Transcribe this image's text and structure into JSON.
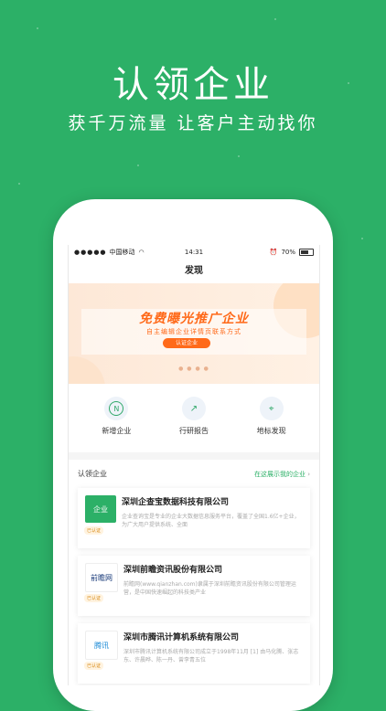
{
  "hero": {
    "title": "认领企业",
    "subtitle": "获千万流量 让客户主动找你"
  },
  "status": {
    "signal": "●●●●●",
    "carrier": "中国移动",
    "wifi": "WiFi",
    "time": "14:31",
    "battery": "70%"
  },
  "nav": {
    "title": "发现"
  },
  "banner": {
    "title": "免费曝光推广企业",
    "subtitle": "自主编辑企业详情页联系方式",
    "button": "认证企业",
    "dots": "● ● ● ●"
  },
  "shortcuts": [
    {
      "label": "新增企业",
      "icon": "N"
    },
    {
      "label": "行研报告",
      "icon": "↗"
    },
    {
      "label": "地标发现",
      "icon": "⌖"
    }
  ],
  "section": {
    "title": "认领企业",
    "link": "在这展示我的企业",
    "chevron": "›"
  },
  "companies": [
    {
      "name": "深圳企查宝数据科技有限公司",
      "logo": "企业",
      "badge": "已认证",
      "desc": "企业查询宝是专业的企业大数据信息服务平台，覆盖了全国1.6亿+企业，为广大用户提供系统、全面"
    },
    {
      "name": "深圳前瞻资讯股份有限公司",
      "logo": "前瞻网",
      "badge": "已认证",
      "desc": "前瞻网(www.qianzhan.com)隶属于深圳前瞻资讯股份有限公司管理运营，是中国快速崛起的科技类产业"
    },
    {
      "name": "深圳市腾讯计算机系统有限公司",
      "logo": "腾讯",
      "badge": "已认证",
      "desc": "深圳市腾讯计算机系统有限公司成立于1998年11月 [1] 由马化腾、张志东、许晨晔、陈一丹、曾李青五位"
    }
  ]
}
